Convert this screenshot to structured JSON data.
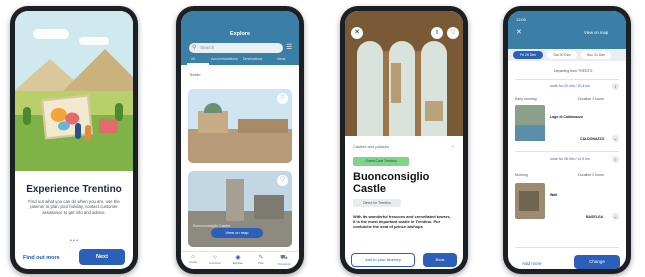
{
  "phone1": {
    "title": "Experience Trentino",
    "description": "Find out what you can do when you are, use the planner to plan your holiday, contact customer assistance to get info and advice.",
    "pager": "• • •",
    "find_out_more": "Find out more",
    "next": "Next"
  },
  "phone2": {
    "title": "Explore",
    "search_placeholder": "Search",
    "tabs": [
      "All",
      "Accommodations",
      "Destinations",
      "Ideas"
    ],
    "filter_label": "Trento",
    "map_button": "View on map",
    "ghost_caption": "Buonconsiglio Castle",
    "nav": [
      "Guide",
      "Activities",
      "Explore",
      "Plan",
      "Transport"
    ]
  },
  "phone3": {
    "category": "Castles and palaces",
    "badge": "Guest Card Trentino",
    "name": "Buonconsiglio Castle",
    "directions": "Direct for Trentino",
    "body": "With its wonderful frescoes and crenellated towers, it is the most important castle in Trentino. Pur contuiche the seat of prince-bishops",
    "add_button": "Add to your itinerary",
    "book_button": "Book"
  },
  "phone4": {
    "time": "12:00",
    "view_on_map": "View on map",
    "chips": [
      "Fri 29 Dec",
      "Sat 30 Dec",
      "Sun 31 Dec"
    ],
    "departing": "Departing from TRENTO",
    "route1": "route for 20 min / 10,4 km",
    "stop1_label": "Early morning",
    "stop1_duration": "Duration 2 hours",
    "stop1_title": "Lago di Caldonazzo",
    "stop1_place": "CALDONAZZO",
    "route2": "route for 28 min / 12,9 km",
    "stop2_label": "Morning",
    "stop2_duration": "Duration 2 hours",
    "stop2_title": "Wait",
    "stop2_place": "BASELGA",
    "add_more": "Add more",
    "change": "Change"
  }
}
